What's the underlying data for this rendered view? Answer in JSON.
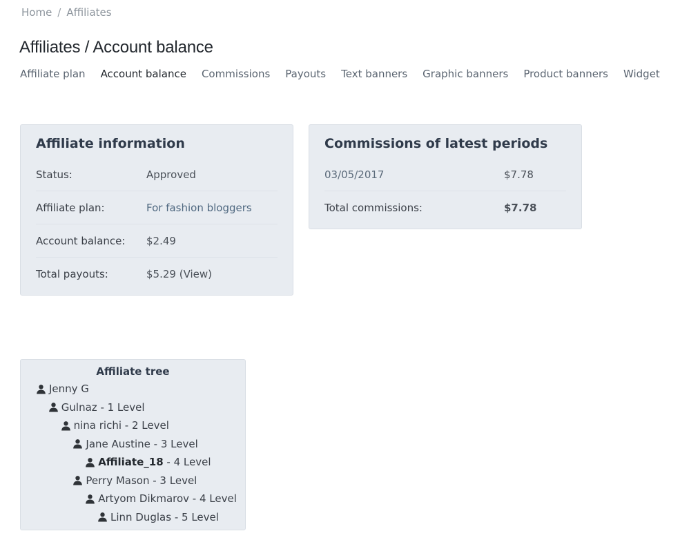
{
  "breadcrumb": {
    "home": "Home",
    "separator": "/",
    "current": "Affiliates"
  },
  "page": {
    "title": "Affiliates / Account balance"
  },
  "tabs": [
    {
      "label": "Affiliate plan",
      "active": false
    },
    {
      "label": "Account balance",
      "active": true
    },
    {
      "label": "Commissions",
      "active": false
    },
    {
      "label": "Payouts",
      "active": false
    },
    {
      "label": "Text banners",
      "active": false
    },
    {
      "label": "Graphic banners",
      "active": false
    },
    {
      "label": "Product banners",
      "active": false
    },
    {
      "label": "Widget",
      "active": false
    }
  ],
  "affiliate_info": {
    "title": "Affiliate information",
    "status_label": "Status:",
    "status_value": "Approved",
    "plan_label": "Affiliate plan:",
    "plan_value": "For fashion bloggers",
    "balance_label": "Account balance:",
    "balance_value": "$2.49",
    "payouts_label": "Total payouts:",
    "payouts_value": "$5.29",
    "payouts_view": "(View)"
  },
  "commissions": {
    "title": "Commissions of latest periods",
    "rows": [
      {
        "date": "03/05/2017",
        "amount": "$7.78"
      }
    ],
    "total_label": "Total commissions:",
    "total_value": "$7.78"
  },
  "tree": {
    "title": "Affiliate tree",
    "icon": "user-icon",
    "nodes": [
      {
        "name": "Jenny G",
        "suffix": "",
        "depth": 0,
        "current": false
      },
      {
        "name": "Gulnaz",
        "suffix": " - 1 Level",
        "depth": 1,
        "current": false
      },
      {
        "name": "nina richi",
        "suffix": " - 2 Level",
        "depth": 2,
        "current": false
      },
      {
        "name": "Jane Austine",
        "suffix": " - 3 Level",
        "depth": 3,
        "current": false
      },
      {
        "name": "Affiliate_18",
        "suffix": " - 4 Level",
        "depth": 4,
        "current": true
      },
      {
        "name": "Perry Mason",
        "suffix": " - 3 Level",
        "depth": 3,
        "current": false
      },
      {
        "name": "Artyom Dikmarov",
        "suffix": " - 4 Level",
        "depth": 4,
        "current": false
      },
      {
        "name": "Linn Duglas",
        "suffix": " - 5 Level",
        "depth": 5,
        "current": false
      }
    ]
  }
}
